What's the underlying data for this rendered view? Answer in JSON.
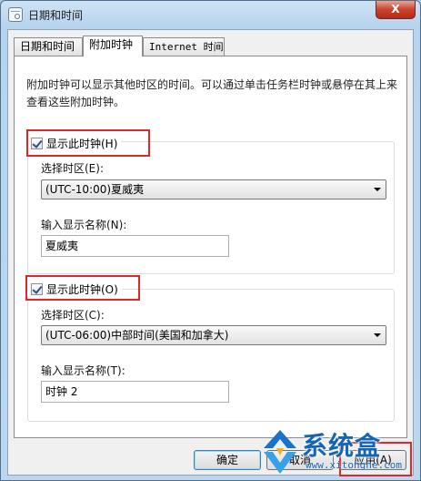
{
  "window": {
    "title": "日期和时间",
    "close_label": "X"
  },
  "tabs": [
    {
      "label": "日期和时间"
    },
    {
      "label": "附加时钟"
    },
    {
      "label": "Internet 时间"
    }
  ],
  "description": "附加时钟可以显示其他时区的时间。可以通过单击任务栏时钟或悬停在其上来查看这些附加时钟。",
  "clock1": {
    "checkbox_label": "显示此时钟(H)",
    "checked": true,
    "timezone_label": "选择时区(E):",
    "timezone_value": "(UTC-10:00)夏威夷",
    "name_label": "输入显示名称(N):",
    "name_value": "夏威夷"
  },
  "clock2": {
    "checkbox_label": "显示此时钟(O)",
    "checked": true,
    "timezone_label": "选择时区(C):",
    "timezone_value": "(UTC-06:00)中部时间(美国和加拿大)",
    "name_label": "输入显示名称(T):",
    "name_value": "时钟 2"
  },
  "buttons": {
    "ok": "确定",
    "cancel": "取消",
    "apply": "应用(A)"
  },
  "watermark": {
    "brand": "系统盒",
    "url": "www.xitonghe.com"
  },
  "colors": {
    "highlight_box": "#e0262b",
    "watermark_blue": "#1565b5"
  }
}
